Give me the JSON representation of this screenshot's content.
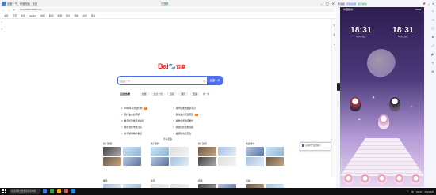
{
  "browser": {
    "title": "百度一下，你就知道 - 百度",
    "badge": "已登录",
    "url": "https://www.baidu.com",
    "nav_back": "←",
    "nav_forward": "→",
    "nav_refresh": "⟳",
    "win_min": "–",
    "win_max": "▢",
    "win_close": "✕",
    "bookmarks": [
      "书签",
      "百度",
      "新闻",
      "hao123",
      "地图",
      "贴吧",
      "视频",
      "图片",
      "网盘",
      "文库",
      "更多"
    ]
  },
  "baidu": {
    "logo_text": "Bai",
    "logo_paw": "🐾",
    "logo_du": "百度",
    "search_placeholder": "百度一下",
    "search_button": "百度一下",
    "hot_label": "百度热搜",
    "chips": [
      "热搜",
      "文心一言",
      "知识",
      "翻译",
      "更多"
    ],
    "refresh": "换一换",
    "hot_items": [
      {
        "num": "1",
        "text": "2024年高考进行时"
      },
      {
        "num": "4",
        "text": "新华社发布最新消息"
      },
      {
        "num": "2",
        "text": "国内油价迎调整"
      },
      {
        "num": "5",
        "text": "多地发布高温预警"
      },
      {
        "num": "3",
        "text": "数字经济发展新动能"
      },
      {
        "num": "6",
        "text": "夏季出游热度攀升"
      },
      {
        "num": "4",
        "text": "各地消费市场活跃"
      },
      {
        "num": "7",
        "text": "科技创新成果亮相"
      },
      {
        "num": "5",
        "text": "体育赛事精彩看点"
      },
      {
        "num": "8",
        "text": "暑期档电影预告"
      }
    ],
    "feed_link": "查看更多",
    "cards": [
      {
        "head": "热门视频"
      },
      {
        "head": "热门图片"
      },
      {
        "head": "热门资讯"
      },
      {
        "head": "精选推荐"
      }
    ],
    "lower_cards": [
      {
        "head": "推荐"
      },
      {
        "head": "资讯"
      },
      {
        "head": "视频"
      },
      {
        "head": "更多"
      }
    ]
  },
  "notification": {
    "text": "已同步至百度账号"
  },
  "phone": {
    "app_name": "传说娃",
    "brand": "手机投屏",
    "status": "连接成功",
    "ctl_pin": "📌",
    "ctl_min": "–",
    "ctl_close": "✕",
    "statusbar_left": "中国移动",
    "statusbar_right": "100%",
    "clock1_time": "18:31",
    "clock1_date": "6月5日 周三",
    "clock2_time": "18:31",
    "clock2_date": "6月5日 周三",
    "side_buttons": [
      "⌂",
      "◁",
      "▢",
      "⚙",
      "⤢",
      "🔊",
      "✎",
      "⊞"
    ]
  },
  "taskbar": {
    "search_placeholder": "在这里输入你要搜索的内容",
    "tray_lang": "中",
    "tray_time": "18:31",
    "tray_date": "2024/6/5"
  },
  "colors": {
    "baidu_blue": "#4e6ef2",
    "baidu_red": "#e22222",
    "phone_bg": "#4b3a7c"
  }
}
